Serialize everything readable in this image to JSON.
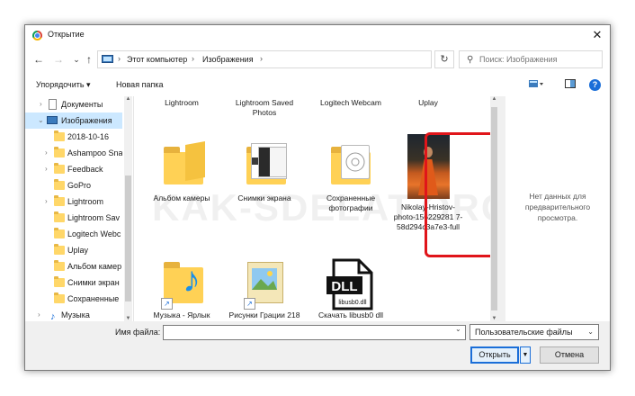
{
  "window": {
    "title": "Открытие",
    "close_glyph": "✕"
  },
  "address": {
    "crumbs": [
      "Этот компьютер",
      "Изображения"
    ],
    "separator": "›",
    "dropdown_glyph": "⌄",
    "refresh_glyph": "↻"
  },
  "nav_buttons": {
    "back": "←",
    "forward": "→",
    "down": "⌄",
    "up": "↑"
  },
  "search": {
    "placeholder": "Поиск: Изображения"
  },
  "toolbar": {
    "organize": "Упорядочить ▾",
    "new_folder": "Новая папка",
    "help": "?"
  },
  "sidebar": {
    "items": [
      {
        "label": "Документы",
        "icon": "document-icon"
      },
      {
        "label": "Изображения",
        "icon": "pictures-icon",
        "selected": true
      },
      {
        "label": "2018-10-16",
        "icon": "folder-icon"
      },
      {
        "label": "Ashampoo Sna",
        "icon": "folder-icon"
      },
      {
        "label": "Feedback",
        "icon": "folder-icon"
      },
      {
        "label": "GoPro",
        "icon": "folder-icon"
      },
      {
        "label": "Lightroom",
        "icon": "folder-icon"
      },
      {
        "label": "Lightroom Sav",
        "icon": "folder-icon"
      },
      {
        "label": "Logitech Webc",
        "icon": "folder-icon"
      },
      {
        "label": "Uplay",
        "icon": "folder-icon"
      },
      {
        "label": "Альбом камер",
        "icon": "folder-icon"
      },
      {
        "label": "Снимки экран",
        "icon": "folder-icon"
      },
      {
        "label": "Сохраненные",
        "icon": "folder-icon"
      },
      {
        "label": "Музыка",
        "icon": "music-icon"
      }
    ]
  },
  "files": {
    "top_row": [
      "Lightroom",
      "Lightroom Saved Photos",
      "Logitech Webcam",
      "Uplay"
    ],
    "row1": [
      {
        "label": "Альбом камеры"
      },
      {
        "label": "Снимки экрана"
      },
      {
        "label": "Сохраненные фотографии"
      },
      {
        "label": "Nikolay-Hristov-photo-156229281 7-58d294c3a7e3-full"
      }
    ],
    "row2": [
      {
        "label": "Музыка - Ярлык"
      },
      {
        "label": "Рисунки Грации 218"
      },
      {
        "label": "Скачать libusb0 dll"
      }
    ],
    "dll_text": "DLL",
    "dll_caption": "libusb0.dll"
  },
  "watermark": "KAK-SDELAT.ORG",
  "preview": {
    "text": "Нет данных для предварительного просмотра."
  },
  "bottom": {
    "filename_label": "Имя файла:",
    "filename_value": "",
    "filetype": "Пользовательские файлы",
    "open": "Открыть",
    "cancel": "Отмена"
  },
  "colors": {
    "accent": "#1a6ed8",
    "highlight": "#e0151a",
    "selection": "#cce8ff"
  }
}
